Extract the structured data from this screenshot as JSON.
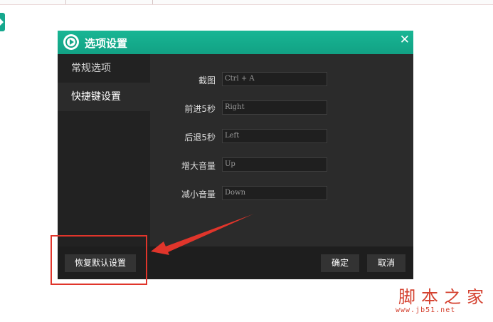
{
  "dialog": {
    "title": "选项设置",
    "logo_icon": "video-player-logo-icon",
    "close_icon": "close-icon",
    "close_glyph": "✕"
  },
  "nav": {
    "items": [
      {
        "label": "常规选项",
        "active": false
      },
      {
        "label": "快捷键设置",
        "active": true
      }
    ]
  },
  "shortcuts": [
    {
      "label": "截图",
      "value": "Ctrl + A"
    },
    {
      "label": "前进5秒",
      "value": "Right"
    },
    {
      "label": "后退5秒",
      "value": "Left"
    },
    {
      "label": "增大音量",
      "value": "Up"
    },
    {
      "label": "减小音量",
      "value": "Down"
    }
  ],
  "footer": {
    "reset_label": "恢复默认设置",
    "ok_label": "确定",
    "cancel_label": "取消"
  },
  "annotation": {
    "color": "#e0352b",
    "target": "reset-defaults-button"
  },
  "watermark": {
    "text": "脚本之家",
    "url": "www.jb51.net"
  },
  "colors": {
    "titlebar": "#14a587",
    "dialog_bg": "#2b2b2b",
    "nav_bg": "#222222",
    "footer_bg": "#1e1e1e"
  }
}
